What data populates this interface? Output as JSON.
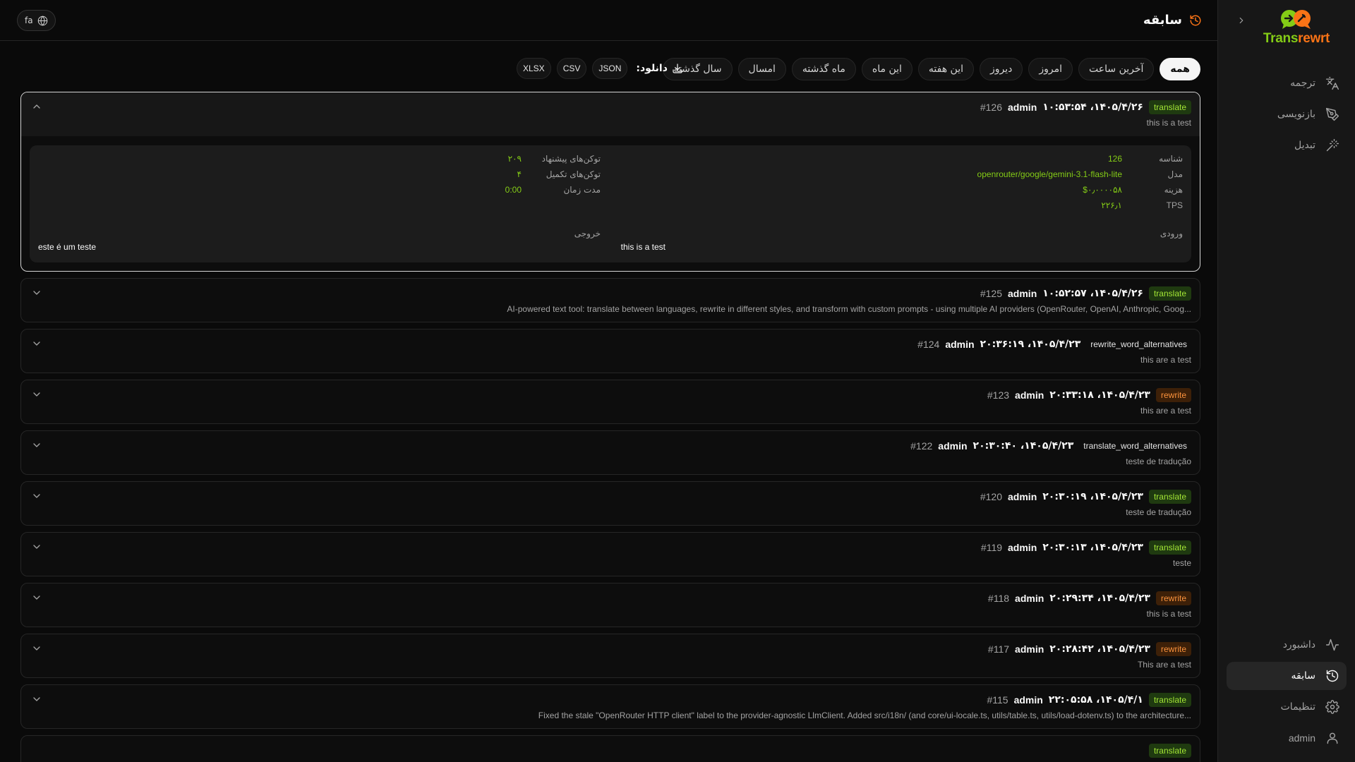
{
  "app": {
    "name_part1": "Trans",
    "name_part2": "rewrt"
  },
  "sidebar": {
    "top_items": [
      {
        "label": "ترجمه",
        "icon": "languages-icon"
      },
      {
        "label": "بازنویسی",
        "icon": "pen-icon"
      },
      {
        "label": "تبدیل",
        "icon": "wand-icon"
      }
    ],
    "bottom_items": [
      {
        "label": "داشبورد",
        "icon": "activity-icon"
      },
      {
        "label": "سابقه",
        "icon": "history-icon",
        "active": true
      },
      {
        "label": "تنظیمات",
        "icon": "gear-icon"
      },
      {
        "label": "admin",
        "icon": "user-icon"
      }
    ]
  },
  "header": {
    "title": "سابقه",
    "lang": "fa"
  },
  "filters": [
    "همه",
    "آخرین ساعت",
    "امروز",
    "دیروز",
    "این هفته",
    "این ماه",
    "ماه گذشته",
    "امسال",
    "سال گذشته"
  ],
  "download": {
    "label": "دانلود:",
    "formats": [
      "JSON",
      "CSV",
      "XLSX"
    ]
  },
  "records": [
    {
      "badge": "translate",
      "badge_type": "translate",
      "timestamp": "۱۴۰۵/۴/۲۶، ۱۰:۵۳:۵۴",
      "user": "admin",
      "id": "#126",
      "preview": "this is a test",
      "expanded": true
    },
    {
      "badge": "translate",
      "badge_type": "translate",
      "timestamp": "۱۴۰۵/۴/۲۶، ۱۰:۵۲:۵۷",
      "user": "admin",
      "id": "#125",
      "preview": "AI-powered text tool: translate between languages, rewrite in different styles, and transform with custom prompts - using multiple AI providers (OpenRouter, OpenAI, Anthropic, Goog..."
    },
    {
      "badge": "rewrite_word_alternatives",
      "badge_type": "plain",
      "timestamp": "۱۴۰۵/۴/۲۳، ۲۰:۳۶:۱۹",
      "user": "admin",
      "id": "#124",
      "preview": "this are a test"
    },
    {
      "badge": "rewrite",
      "badge_type": "rewrite",
      "timestamp": "۱۴۰۵/۴/۲۳، ۲۰:۳۳:۱۸",
      "user": "admin",
      "id": "#123",
      "preview": "this are a test"
    },
    {
      "badge": "translate_word_alternatives",
      "badge_type": "plain",
      "timestamp": "۱۴۰۵/۴/۲۳، ۲۰:۳۰:۴۰",
      "user": "admin",
      "id": "#122",
      "preview": "teste de tradução"
    },
    {
      "badge": "translate",
      "badge_type": "translate",
      "timestamp": "۱۴۰۵/۴/۲۳، ۲۰:۳۰:۱۹",
      "user": "admin",
      "id": "#120",
      "preview": "teste de tradução"
    },
    {
      "badge": "translate",
      "badge_type": "translate",
      "timestamp": "۱۴۰۵/۴/۲۳، ۲۰:۳۰:۱۳",
      "user": "admin",
      "id": "#119",
      "preview": "teste"
    },
    {
      "badge": "rewrite",
      "badge_type": "rewrite",
      "timestamp": "۱۴۰۵/۴/۲۳، ۲۰:۲۹:۳۴",
      "user": "admin",
      "id": "#118",
      "preview": "this is a test"
    },
    {
      "badge": "rewrite",
      "badge_type": "rewrite",
      "timestamp": "۱۴۰۵/۴/۲۳، ۲۰:۲۸:۴۲",
      "user": "admin",
      "id": "#117",
      "preview": "This are a test"
    },
    {
      "badge": "translate",
      "badge_type": "translate",
      "timestamp": "۱۴۰۵/۴/۱، ۲۲:۰۵:۵۸",
      "user": "admin",
      "id": "#115",
      "preview": "Fixed the stale \"OpenRouter HTTP client\" label to the provider-agnostic LlmClient. Added src/i18n/ (and core/ui-locale.ts, utils/table.ts, utils/load-dotenv.ts) to the architecture..."
    },
    {
      "badge": "translate",
      "badge_type": "translate",
      "timestamp": "",
      "user": "",
      "id": "",
      "preview": ""
    }
  ],
  "detail": {
    "id_label": "شناسه",
    "id_value": "126",
    "model_label": "مدل",
    "model_value": "openrouter/google/gemini-3.1-flash-lite",
    "cost_label": "هزینه",
    "cost_value": "$۰٫۰۰۰۰۵۸",
    "tps_label": "TPS",
    "tps_value": "۲۲۶٫۱",
    "prompt_tokens_label": "توکن‌های پیشنهاد",
    "prompt_tokens_value": "۲۰۹",
    "completion_tokens_label": "توکن‌های تکمیل",
    "completion_tokens_value": "۴",
    "duration_label": "مدت زمان",
    "duration_value": "0:00",
    "input_label": "ورودی",
    "input_text": "this is a test",
    "output_label": "خروجی",
    "output_text": "este é um teste"
  },
  "colors": {
    "accent": "#f97316",
    "green": "#84cc16",
    "bg": "#0a0a0a",
    "sidebar": "#171717"
  }
}
